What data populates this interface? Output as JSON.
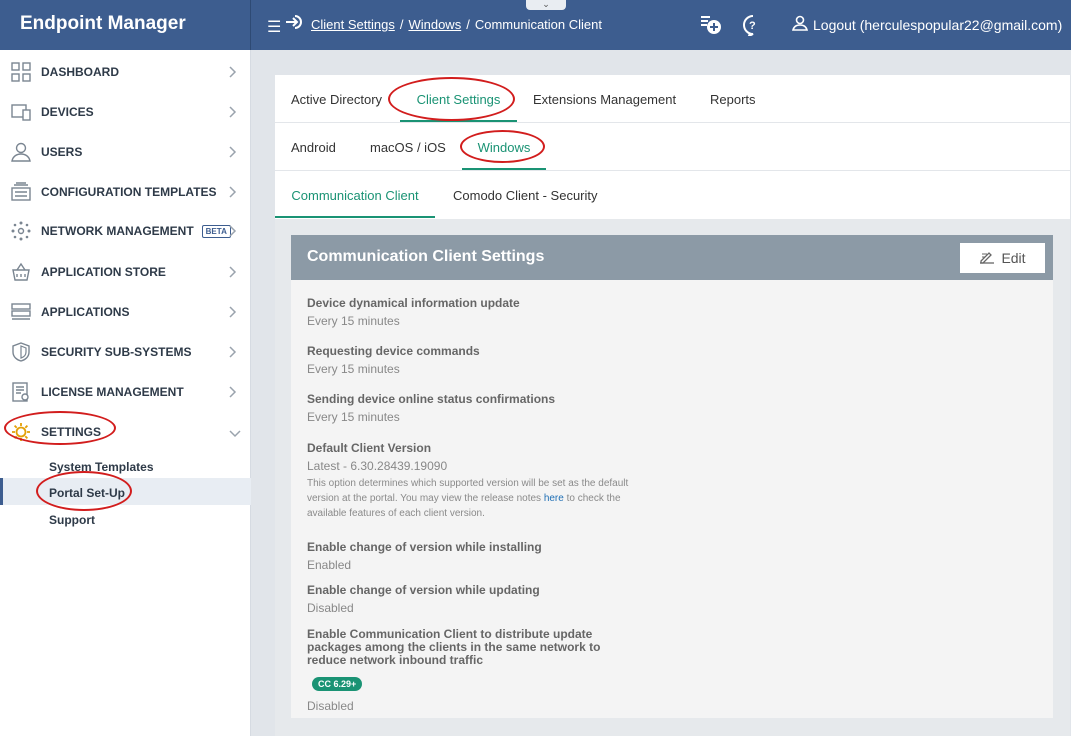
{
  "app": {
    "title": "Endpoint Manager"
  },
  "header": {
    "breadcrumb": [
      {
        "label": "Client Settings",
        "link": true
      },
      {
        "label": "Windows",
        "link": true
      },
      {
        "label": "Communication Client",
        "link": false
      }
    ],
    "separator": "/",
    "logout_label": "Logout (herculespopular22@gmail.com)",
    "icons": [
      "menu-icon",
      "sign-in-icon",
      "add-device-icon",
      "help-icon",
      "user-icon"
    ]
  },
  "sidebar": {
    "items": [
      {
        "label": "DASHBOARD",
        "icon": "dashboard-icon"
      },
      {
        "label": "DEVICES",
        "icon": "devices-icon"
      },
      {
        "label": "USERS",
        "icon": "users-icon"
      },
      {
        "label": "CONFIGURATION TEMPLATES",
        "icon": "templates-icon"
      },
      {
        "label": "NETWORK MANAGEMENT",
        "icon": "network-icon",
        "badge": "BETA"
      },
      {
        "label": "APPLICATION STORE",
        "icon": "store-icon"
      },
      {
        "label": "APPLICATIONS",
        "icon": "applications-icon"
      },
      {
        "label": "SECURITY SUB-SYSTEMS",
        "icon": "shield-icon"
      },
      {
        "label": "LICENSE MANAGEMENT",
        "icon": "license-icon"
      },
      {
        "label": "SETTINGS",
        "icon": "gear-icon",
        "expanded": true
      }
    ],
    "settings_sub": [
      {
        "label": "System Templates"
      },
      {
        "label": "Portal Set-Up",
        "active": true
      },
      {
        "label": "Support"
      }
    ]
  },
  "tabs": {
    "top": [
      "Active Directory",
      "Client Settings",
      "Extensions Management",
      "Reports"
    ],
    "top_active": "Client Settings",
    "os": [
      "Android",
      "macOS / iOS",
      "Windows"
    ],
    "os_active": "Windows",
    "client": [
      "Communication Client",
      "Comodo Client - Security"
    ],
    "client_active": "Communication Client"
  },
  "card": {
    "title": "Communication Client Settings",
    "edit_label": "Edit",
    "fields": [
      {
        "label": "Device dynamical information update",
        "value": "Every 15 minutes"
      },
      {
        "label": "Requesting device commands",
        "value": "Every 15 minutes"
      },
      {
        "label": "Sending device online status confirmations",
        "value": "Every 15 minutes"
      },
      {
        "label": "Default Client Version",
        "value": "Latest - 6.30.28439.19090",
        "note_before": "This option determines which supported version will be set as the default version at the portal. You may view the release notes ",
        "note_link": "here",
        "note_after": " to check the available features of each client version."
      },
      {
        "label": "Enable change of version while installing",
        "value": "Enabled"
      },
      {
        "label": "Enable change of version while updating",
        "value": "Disabled"
      },
      {
        "label": "Enable Communication Client to distribute update packages among the clients in the same network to reduce network inbound traffic",
        "badge": "CC 6.29+",
        "value": "Disabled"
      }
    ]
  },
  "colors": {
    "header_bg": "#3d5d8f",
    "accent_green": "#1a9374",
    "annotation_red": "#d21d1d",
    "card_header": "#8c9aa6"
  }
}
